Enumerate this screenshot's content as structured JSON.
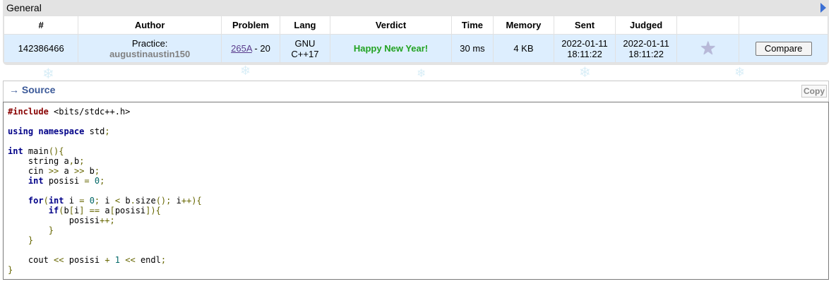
{
  "general": {
    "title": "General",
    "headers": [
      "#",
      "Author",
      "Problem",
      "Lang",
      "Verdict",
      "Time",
      "Memory",
      "Sent",
      "Judged",
      "",
      ""
    ],
    "row": {
      "id": "142386466",
      "author_type": "Practice:",
      "author_name": "augustinaustin150",
      "problem_link": "265A",
      "problem_suffix": " - 20",
      "lang_line1": "GNU",
      "lang_line2": "C++17",
      "verdict": "Happy New Year!",
      "time": "30 ms",
      "memory": "4 KB",
      "sent_date": "2022-01-11",
      "sent_time": "18:11:22",
      "judged_date": "2022-01-11",
      "judged_time": "18:11:22",
      "favorite_icon": "star-icon",
      "compare_label": "Compare"
    }
  },
  "source": {
    "title": "→ Source",
    "copy_label": "Copy",
    "code": "#include <bits/stdc++.h>\n\nusing namespace std;\n\nint main(){\n    string a,b;\n    cin >> a >> b;\n    int posisi = 0;\n\n    for(int i = 0; i < b.size(); i++){\n        if(b[i] == a[posisi]){\n            posisi++;\n        }\n    }\n\n    cout << posisi + 1 << endl;\n}"
  },
  "colors": {
    "verdict_accepted": "#22a322",
    "header_bg": "#e3e3e3",
    "row_bg": "#ddeefe",
    "source_title": "#3b5998"
  }
}
